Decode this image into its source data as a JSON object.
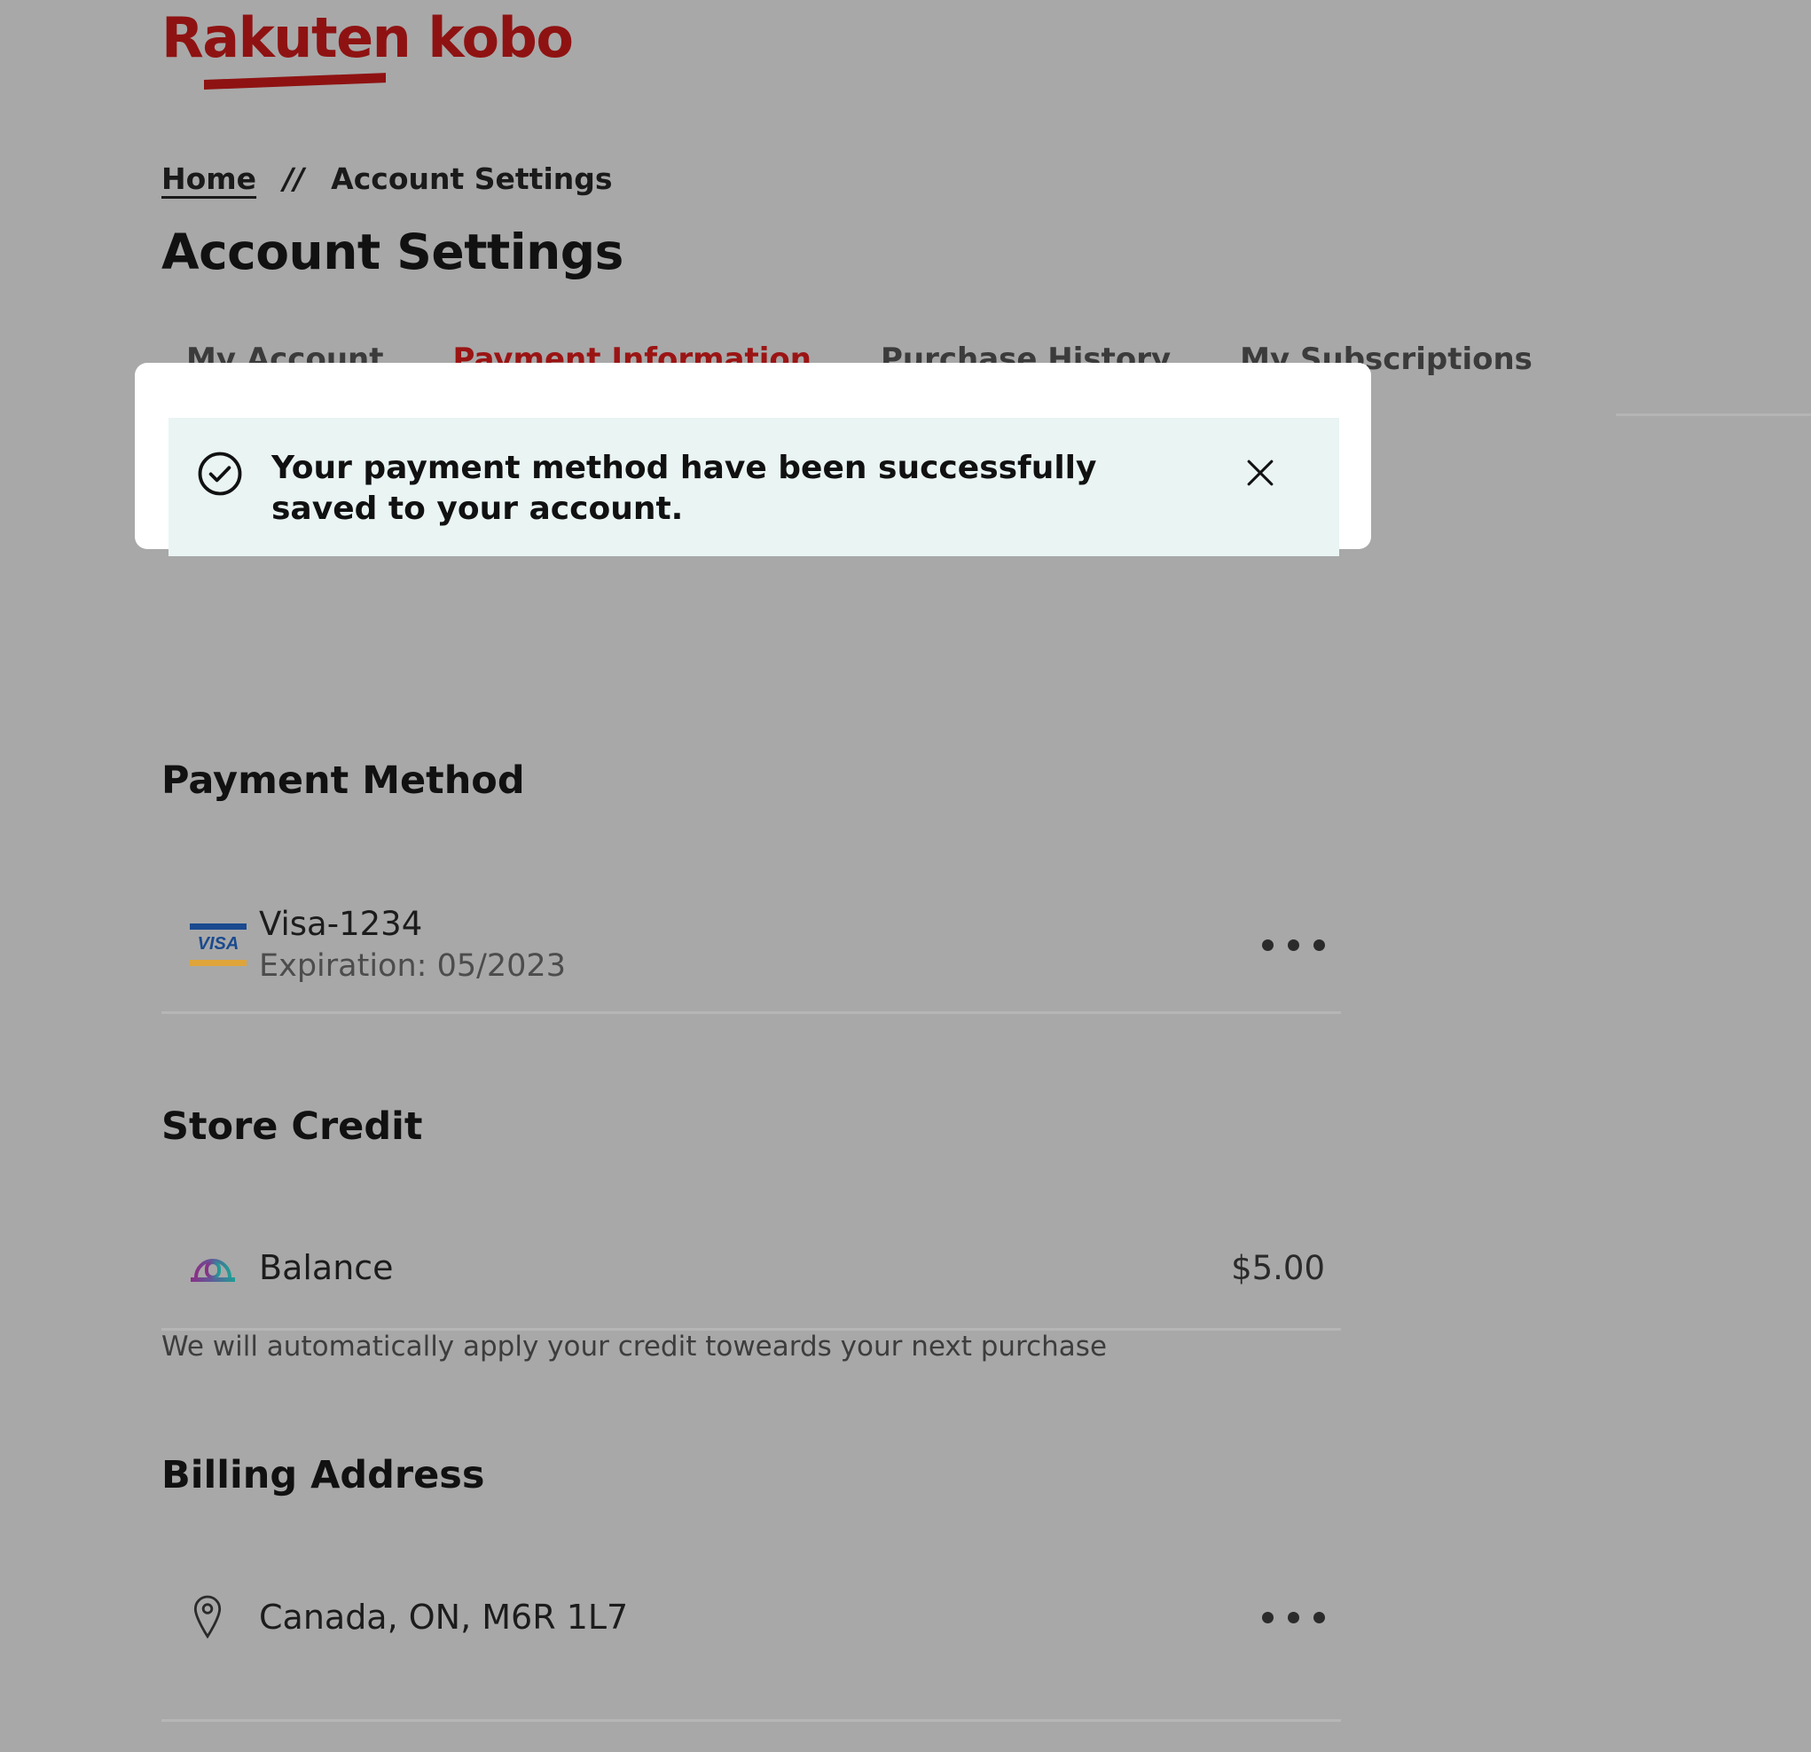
{
  "brand": {
    "rakuten": "Rakuten",
    "kobo": "kobo",
    "color": "#8f1212"
  },
  "breadcrumb": {
    "home": "Home",
    "separator": "//",
    "current": "Account Settings"
  },
  "header": {
    "title": "Account Settings"
  },
  "tabs": [
    {
      "label": "My Account",
      "active": false
    },
    {
      "label": "Payment Information",
      "active": true
    },
    {
      "label": "Purchase History",
      "active": false
    },
    {
      "label": "My Subscriptions",
      "active": false
    }
  ],
  "toast": {
    "message": "Your payment method have been successfully saved to your account.",
    "icon": "check-circle-icon",
    "close_icon": "close-icon",
    "background": "#e9f4f3",
    "card_background": "#ffffff"
  },
  "payment_method": {
    "heading": "Payment Method",
    "card": {
      "brand_icon": "visa-logo-icon",
      "brand_word": "VISA",
      "name": "Visa-1234",
      "expiration": "Expiration: 05/2023",
      "menu_icon": "more-options-icon"
    }
  },
  "store_credit": {
    "heading": "Store Credit",
    "icon": "store-credit-icon",
    "label": "Balance",
    "amount": "$5.00",
    "note": "We will automatically apply your credit toweards your next purchase"
  },
  "billing_address": {
    "heading": "Billing Address",
    "icon": "map-pin-icon",
    "address": "Canada, ON, M6R 1L7",
    "menu_icon": "more-options-icon"
  }
}
